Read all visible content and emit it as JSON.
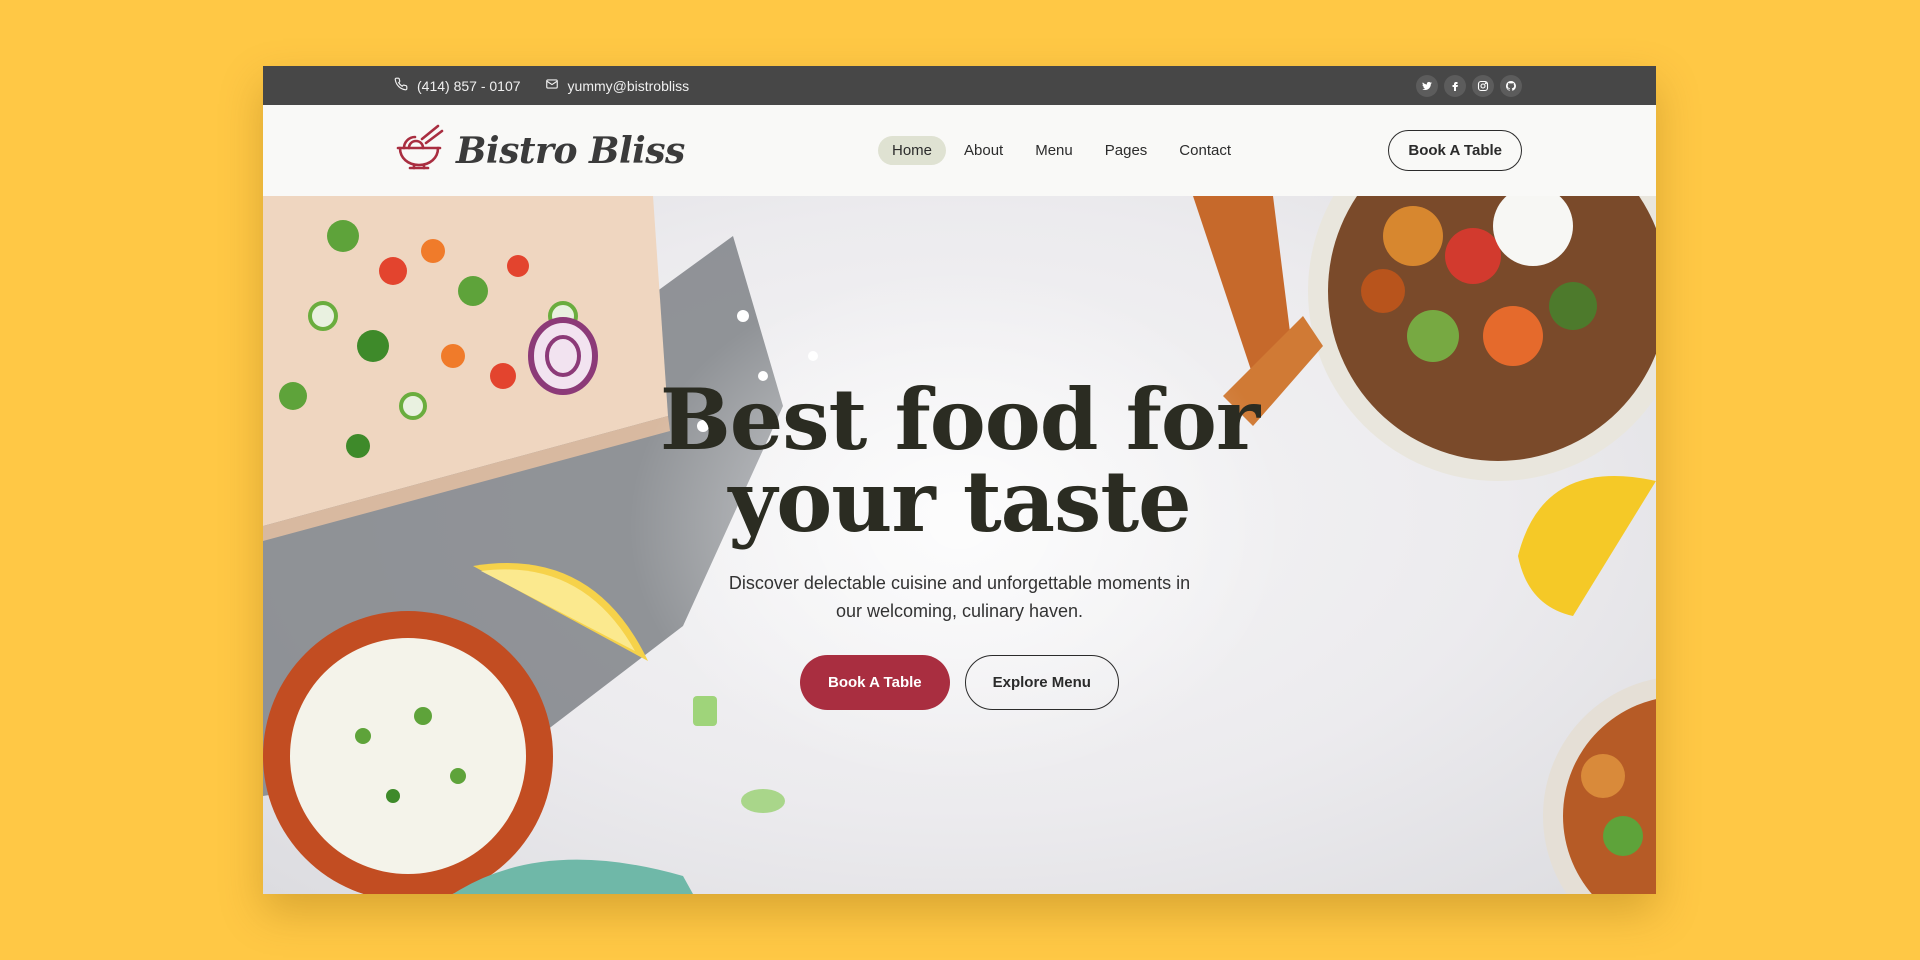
{
  "topbar": {
    "phone": "(414) 857 - 0107",
    "email": "yummy@bistrobliss",
    "socials": [
      "twitter-icon",
      "facebook-icon",
      "instagram-icon",
      "github-icon"
    ]
  },
  "brand": {
    "name": "Bistro Bliss",
    "accent": "#a92e40"
  },
  "nav": {
    "items": [
      {
        "label": "Home",
        "active": true
      },
      {
        "label": "About",
        "active": false
      },
      {
        "label": "Menu",
        "active": false
      },
      {
        "label": "Pages",
        "active": false
      },
      {
        "label": "Contact",
        "active": false
      }
    ],
    "cta_label": "Book A Table"
  },
  "hero": {
    "title": "Best food for\nyour taste",
    "subtitle": "Discover delectable cuisine and unforgettable moments in our welcoming, culinary haven.",
    "primary_label": "Book A Table",
    "secondary_label": "Explore Menu"
  },
  "colors": {
    "page_bg": "#FFC845",
    "topbar_bg": "#474747",
    "primary": "#a92e40"
  }
}
